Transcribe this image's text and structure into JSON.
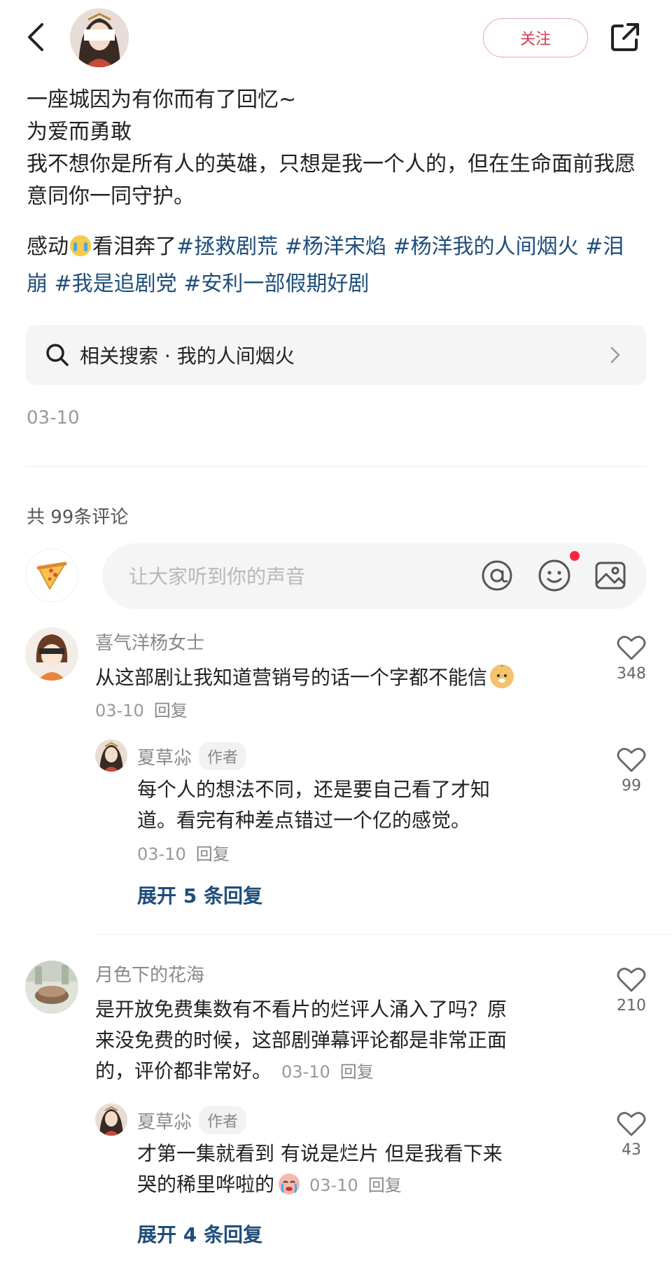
{
  "header": {
    "follow_label": "关注"
  },
  "post": {
    "lines": [
      "一座城因为有你而有了回忆~",
      "为爱而勇敢",
      "我不想你是所有人的英雄，只想是我一个人的，但在生命面前我愿意同你一同守护。"
    ],
    "tag_prefix_1": "感动",
    "tag_prefix_2": "看泪奔了",
    "tags": [
      "#拯救剧荒",
      "#杨洋宋焰",
      "#杨洋我的人间烟火",
      "#泪崩",
      "#我是追剧党",
      "#安利一部假期好剧"
    ],
    "related_search": "相关搜索 · 我的人间烟火",
    "date": "03-10"
  },
  "comments_section": {
    "count_label": "共 99条评论",
    "input_placeholder": "让大家听到你的声音",
    "comments": [
      {
        "name": "喜气洋杨女士",
        "text": "从这部剧让我知道营销号的话一个字都不能信",
        "date": "03-10",
        "reply_label": "回复",
        "likes": "348",
        "reply": {
          "name": "夏草尛",
          "badge": "作者",
          "text_line1": "每个人的想法不同，还是要自己看了才知",
          "text_line2": "道。看完有种差点错过一个亿的感觉。",
          "date": "03-10",
          "reply_label": "回复",
          "likes": "99"
        },
        "expand_label": "展开 5 条回复"
      },
      {
        "name": "月色下的花海",
        "text_line1": "是开放免费集数有不看片的烂评人涌入了吗？原",
        "text_line2": "来没免费的时候，这部剧弹幕评论都是非常正面",
        "text_line3": "的，评价都非常好。",
        "date": "03-10",
        "reply_label": "回复",
        "likes": "210",
        "reply": {
          "name": "夏草尛",
          "badge": "作者",
          "text_line1": "才第一集就看到 有说是烂片 但是我看下来",
          "text_line2": "哭的稀里哗啦的",
          "date": "03-10",
          "reply_label": "回复",
          "likes": "43"
        },
        "expand_label": "展开 4 条回复"
      }
    ]
  },
  "icons": {
    "back": "chevron-left-icon",
    "share": "share-icon",
    "search": "search-icon",
    "at": "at-icon",
    "emoji": "smiley-icon",
    "image": "image-icon",
    "like": "heart-icon"
  },
  "colors": {
    "accent": "#d63d4f",
    "tag": "#1f4d7a",
    "notification_dot": "#ff2442"
  }
}
